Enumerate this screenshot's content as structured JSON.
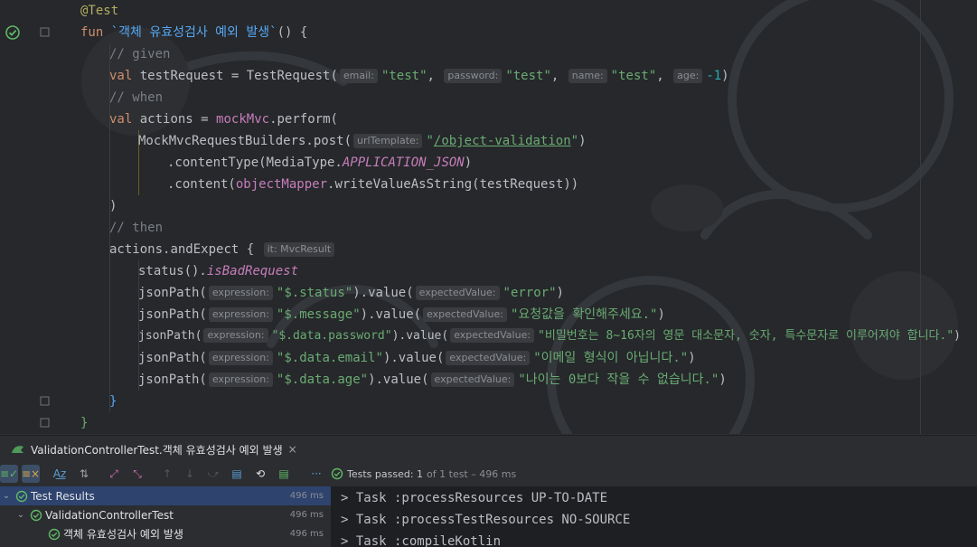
{
  "editor": {
    "annotation": "@Test",
    "fun_kw": "fun",
    "fun_name": "`객체 유효성검사 예외 발생`",
    "fun_tail": "() {",
    "c_given": "// given",
    "c_when": "// when",
    "c_then": "// then",
    "val_kw": "val",
    "v_testRequest": "testRequest",
    "eq": " = ",
    "TestRequest": "TestRequest(",
    "hint_email": "email:",
    "hint_password": "password:",
    "hint_name": "name:",
    "hint_age": "age:",
    "s_test": "\"test\"",
    "comma": ", ",
    "neg_one": "-1",
    "close_paren": ")",
    "v_actions": "actions",
    "mockMvc": "mockMvc",
    "dot_perform": ".perform(",
    "MockMvcRequestBuilders": "MockMvcRequestBuilders.",
    "post": "post(",
    "hint_urlTemplate": "urlTemplate:",
    "s_url_q1": "\"",
    "s_url": "/object-validation",
    "s_url_q2": "\"",
    "dot_contentType": ".contentType(",
    "MediaType": "MediaType.",
    "APPLICATION_JSON": "APPLICATION_JSON",
    "dot_content": ".content(",
    "objectMapper": "objectMapper",
    "dot_write": ".writeValueAsString(",
    "testRequest_ref": "testRequest",
    "close2": "))",
    "actions_ref": "actions",
    "andExpect": ".andExpect",
    "open_brace": " {",
    "hint_it": "it: MvcResult",
    "status_fn": "status",
    "status_paren": "().",
    "isBadRequest": "isBadRequest",
    "jsonPath": "jsonPath(",
    "hint_expression": "expression:",
    "hint_expectedValue": "expectedValue:",
    "q": "\"",
    "path_status": "$.status",
    "path_message": "$.message",
    "path_password": "$.data.password",
    "path_email": "$.data.email",
    "path_age": "$.data.age",
    "dot_value": ").value(",
    "s_error": "\"error\"",
    "s_msg": "\"요청값을 확인해주세요.\"",
    "s_pw": "\"비밀번호는 8~16자의 영문 대소문자, 숫자, 특수문자로 이루어져야 합니다.\"",
    "s_email": "\"이메일 형식이 아닙니다.\"",
    "s_age": "\"나이는 0보다 작을 수 없습니다.\"",
    "close_brace": "}"
  },
  "run_tab": {
    "label": "ValidationControllerTest.객체 유효성검사 예외 발생",
    "close": "×"
  },
  "toolbar": {
    "status_label": "Tests passed:",
    "status_count": "1",
    "status_sub": "of 1 test – 496 ms",
    "more": "···"
  },
  "tree": [
    {
      "label": "Test Results",
      "time": "496 ms"
    },
    {
      "label": "ValidationControllerTest",
      "time": "496 ms"
    },
    {
      "label": "객체 유효성검사 예외 발생",
      "time": "496 ms"
    }
  ],
  "console": [
    "> Task :processResources UP-TO-DATE",
    "> Task :processTestResources NO-SOURCE",
    "> Task :compileKotlin"
  ],
  "colors": {
    "pass_green": "#5fb865",
    "keyword": "#cf8e6d",
    "function": "#56a8f5",
    "string": "#6aab73",
    "comment": "#7a7e85"
  }
}
